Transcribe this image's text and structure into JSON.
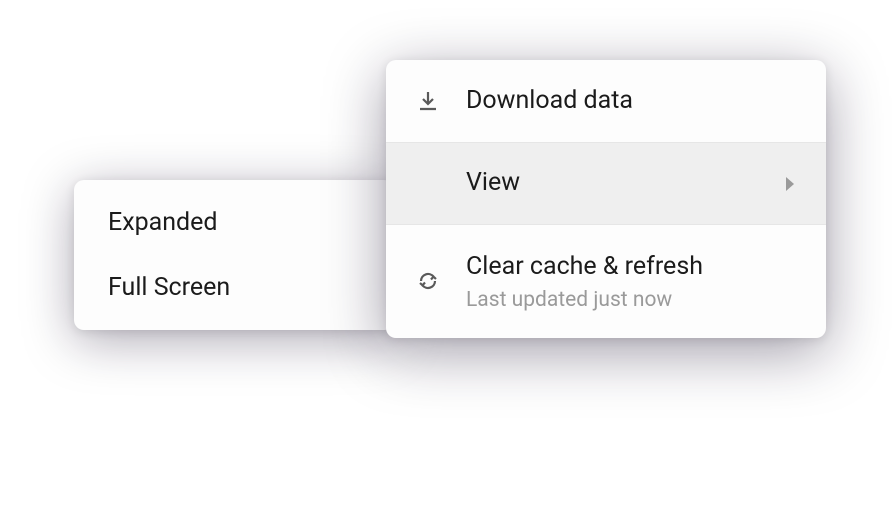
{
  "mainMenu": {
    "download": {
      "label": "Download data"
    },
    "view": {
      "label": "View"
    },
    "clear": {
      "label": "Clear cache & refresh",
      "subtitle": "Last updated just now"
    }
  },
  "viewSubmenu": {
    "items": [
      {
        "label": "Expanded"
      },
      {
        "label": "Full Screen"
      }
    ]
  }
}
